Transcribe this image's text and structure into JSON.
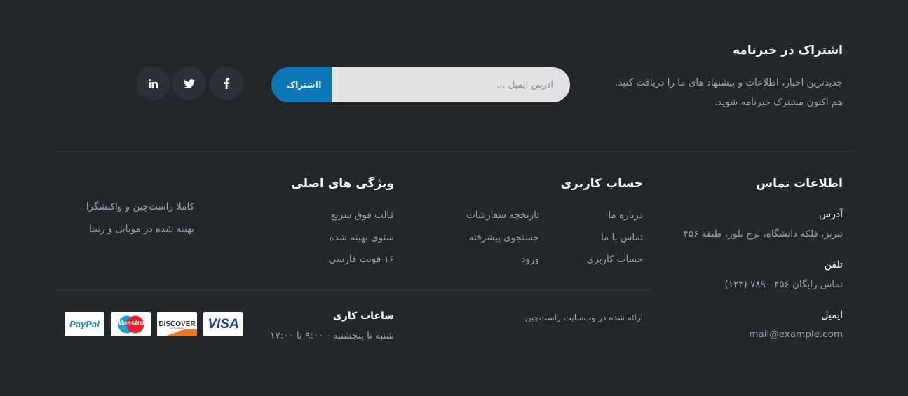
{
  "newsletter": {
    "title": "اشتراک در خبرنامه",
    "desc_line1": "جدیدترین اخبار، اطلاعات و پیشنهاد های ما را دریافت کنید.",
    "desc_line2": "هم اکنون مشترک خبرنامه شوید.",
    "email_placeholder": "آدرس ایمیل ...",
    "subscribe_label": "اشتراک!"
  },
  "social": [
    {
      "name": "facebook",
      "icon": "facebook-icon"
    },
    {
      "name": "twitter",
      "icon": "twitter-icon"
    },
    {
      "name": "linkedin",
      "icon": "linkedin-icon"
    }
  ],
  "contact": {
    "title": "اطلاعات تماس",
    "address_label": "آدرس",
    "address_value": "تبریز، فلکه دانشگاه، برج بلور، طبقه ۴۵۶",
    "phone_label": "تلفن",
    "phone_value": "تماس رایگان ۴۵۶-۷۸۹۰ (۱۲۳)",
    "email_label": "ایمیل",
    "email_value": "mail@example.com"
  },
  "account": {
    "title": "حساب کاربری",
    "links_col1": [
      "درباره ما",
      "تماس با ما",
      "حساب کاربری"
    ],
    "links_col2": [
      "تاریخچه سفارشات",
      "جستجوی پیشرفته",
      "ورود"
    ]
  },
  "features": {
    "title": "ویژگی های اصلی",
    "items": [
      "قالب فوق سریع",
      "سئوی بهینه شده",
      "۱۶ فونت فارسی"
    ],
    "extra": [
      "کاملا راست‌چین و واکنشگرا",
      "بهینه شده در موبایل و رتینا"
    ]
  },
  "bottom": {
    "credit": "ارائه شده در وب‌سایت راست‌چین",
    "hours_title": "ساعات کاری",
    "hours_value": "شنبه تا پنجشنبه - ۹:۰۰ تا ۱۷:۰۰"
  },
  "payment_cards": [
    "VISA",
    "DISCOVER",
    "NETWORK",
    "Maestro",
    "PayPal"
  ],
  "colors": {
    "background": "#23262b",
    "accent": "#0b77b6",
    "text_muted": "#9ea2a8"
  }
}
